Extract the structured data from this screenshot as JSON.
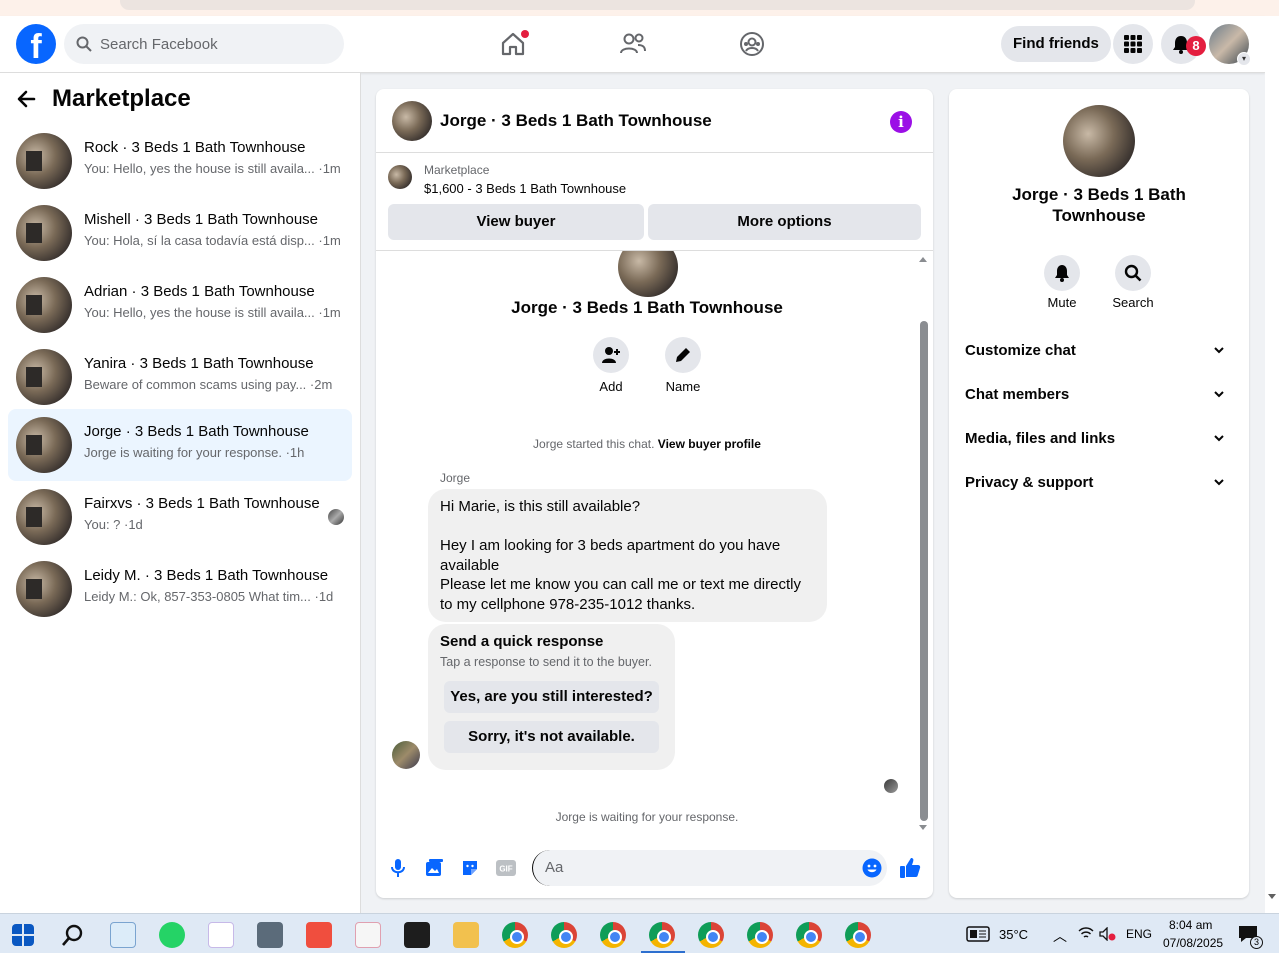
{
  "topbar": {
    "search_placeholder": "Search Facebook",
    "find_friends": "Find friends",
    "notif_count": "8"
  },
  "left": {
    "title": "Marketplace",
    "conversations": [
      {
        "title": "Rock · 3 Beds 1 Bath Townhouse",
        "sub": "You: Hello, yes the house is still availa... ·1m"
      },
      {
        "title": "Mishell · 3 Beds 1 Bath Townhouse",
        "sub": "You: Hola, sí la casa todavía está disp... ·1m"
      },
      {
        "title": "Adrian · 3 Beds 1 Bath Townhouse",
        "sub": "You: Hello, yes the house is still availa... ·1m"
      },
      {
        "title": "Yanira · 3 Beds 1 Bath Townhouse",
        "sub": "Beware of common scams using pay... ·2m"
      },
      {
        "title": "Jorge · 3 Beds 1 Bath Townhouse",
        "sub": "Jorge is waiting for your response. ·1h"
      },
      {
        "title": "Fairxvs · 3 Beds 1 Bath Townhouse",
        "sub": "You: ? ·1d"
      },
      {
        "title": "Leidy M. · 3 Beds 1 Bath Townhouse",
        "sub": "Leidy M.: Ok, 857-353-0805 What tim... ·1d"
      }
    ]
  },
  "chat": {
    "header_name": "Jorge · 3 Beds 1 Bath Townhouse",
    "marketplace_label": "Marketplace",
    "listing": "$1,600 - 3 Beds 1 Bath Townhouse",
    "view_buyer": "View buyer",
    "more_options": "More options",
    "thread_name": "Jorge · 3 Beds 1 Bath Townhouse",
    "add_label": "Add",
    "name_label": "Name",
    "started_text": "Jorge started this chat.",
    "view_buyer_profile": "View buyer profile",
    "sender": "Jorge",
    "message_lines": [
      "Hi Marie, is this still available?",
      "",
      "Hey I am looking for 3 beds apartment do you have available",
      "Please let me know you can call me or text me directly to my cellphone 978-235-1012 thanks."
    ],
    "quick_title": "Send a quick response",
    "quick_sub": "Tap a response to send it to the buyer.",
    "quick_opt1": "Yes, are you still interested?",
    "quick_opt2": "Sorry, it's not available.",
    "waiting": "Jorge is waiting for your response.",
    "input_placeholder": "Aa"
  },
  "right": {
    "name": "Jorge · 3 Beds 1 Bath Townhouse",
    "mute": "Mute",
    "search": "Search",
    "sections": [
      "Customize chat",
      "Chat members",
      "Media, files and links",
      "Privacy & support"
    ]
  },
  "taskbar": {
    "temp": "35°C",
    "lang": "ENG",
    "time": "8:04 am",
    "date": "07/08/2025",
    "notif": "3"
  },
  "colors": {
    "brand": "#0866ff",
    "info": "#9b0fe6",
    "badge": "#e41e3f"
  }
}
